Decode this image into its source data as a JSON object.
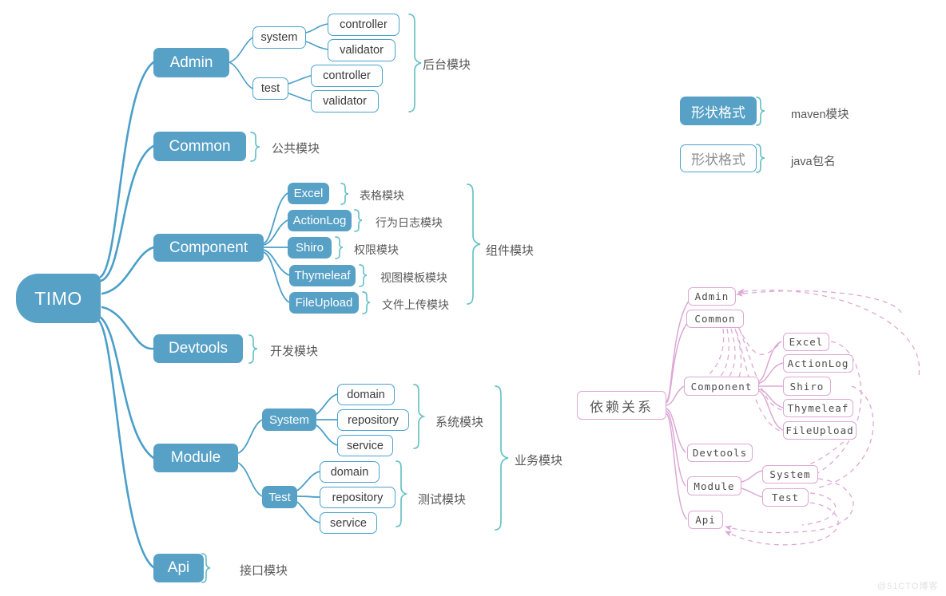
{
  "diagram": {
    "root": {
      "label": "TIMO"
    },
    "branches": [
      {
        "label": "Admin",
        "annotation": "后台模块",
        "children": [
          {
            "label": "system",
            "children": [
              {
                "label": "controller"
              },
              {
                "label": "validator"
              }
            ]
          },
          {
            "label": "test",
            "children": [
              {
                "label": "controller"
              },
              {
                "label": "validator"
              }
            ]
          }
        ]
      },
      {
        "label": "Common",
        "annotation": "公共模块",
        "children": []
      },
      {
        "label": "Component",
        "annotation": "组件模块",
        "children": [
          {
            "label": "Excel",
            "annotation": "表格模块"
          },
          {
            "label": "ActionLog",
            "annotation": "行为日志模块"
          },
          {
            "label": "Shiro",
            "annotation": "权限模块"
          },
          {
            "label": "Thymeleaf",
            "annotation": "视图模板模块"
          },
          {
            "label": "FileUpload",
            "annotation": "文件上传模块"
          }
        ]
      },
      {
        "label": "Devtools",
        "annotation": "开发模块",
        "children": []
      },
      {
        "label": "Module",
        "annotation": "业务模块",
        "children": [
          {
            "label": "System",
            "annotation": "系统模块",
            "children": [
              {
                "label": "domain"
              },
              {
                "label": "repository"
              },
              {
                "label": "service"
              }
            ]
          },
          {
            "label": "Test",
            "annotation": "测试模块",
            "children": [
              {
                "label": "domain"
              },
              {
                "label": "repository"
              },
              {
                "label": "service"
              }
            ]
          }
        ]
      },
      {
        "label": "Api",
        "annotation": "接口模块",
        "children": []
      }
    ]
  },
  "legend": {
    "items": [
      {
        "sample": "形状格式",
        "style": "maven",
        "label": "maven模块"
      },
      {
        "sample": "形状格式",
        "style": "package",
        "label": "java包名"
      }
    ]
  },
  "dependency": {
    "title": "依赖关系",
    "nodes": [
      {
        "id": "admin",
        "label": "Admin"
      },
      {
        "id": "common",
        "label": "Common"
      },
      {
        "id": "component",
        "label": "Component"
      },
      {
        "id": "excel",
        "label": "Excel"
      },
      {
        "id": "actionlog",
        "label": "ActionLog"
      },
      {
        "id": "shiro",
        "label": "Shiro"
      },
      {
        "id": "thymeleaf",
        "label": "Thymeleaf"
      },
      {
        "id": "fileupload",
        "label": "FileUpload"
      },
      {
        "id": "devtools",
        "label": "Devtools"
      },
      {
        "id": "module",
        "label": "Module"
      },
      {
        "id": "system",
        "label": "System"
      },
      {
        "id": "test",
        "label": "Test"
      },
      {
        "id": "api",
        "label": "Api"
      }
    ]
  },
  "watermark": {
    "text": "@51CTO博客"
  },
  "colors": {
    "maven_fill": "#57A0C6",
    "package_border": "#4aa3d0",
    "branch_line": "#4a9fc9",
    "brace": "#69c2c6",
    "dependency": "#dda8d4",
    "annotation_text": "#58585a"
  }
}
